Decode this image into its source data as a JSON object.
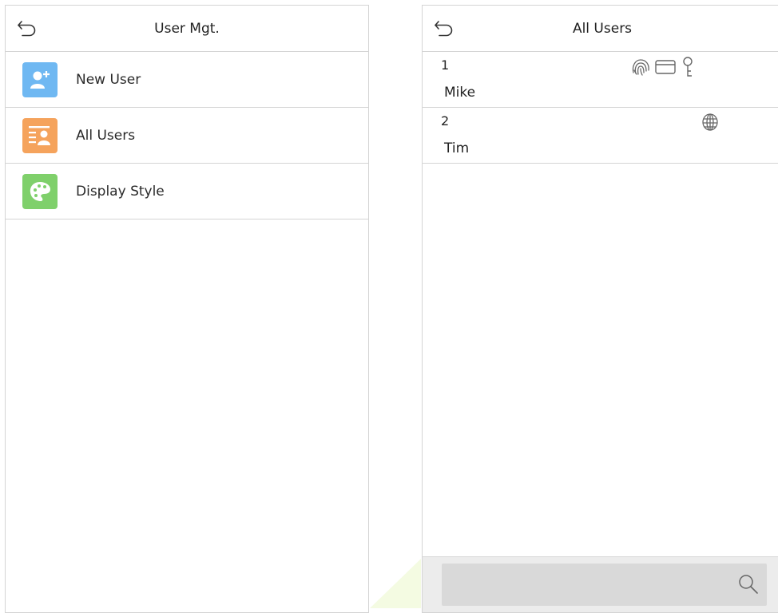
{
  "left_screen": {
    "title": "User Mgt.",
    "menu": [
      {
        "label": "New User",
        "icon": "new-user-icon",
        "color": "#6fb8f2"
      },
      {
        "label": "All Users",
        "icon": "all-users-icon",
        "color": "#f5a35c"
      },
      {
        "label": "Display Style",
        "icon": "palette-icon",
        "color": "#7fd06b"
      }
    ]
  },
  "right_screen": {
    "title": "All Users",
    "users": [
      {
        "id": "1",
        "name": "Mike",
        "verification_icons": [
          "fingerprint-icon",
          "card-icon",
          "key-icon"
        ]
      },
      {
        "id": "2",
        "name": "Tim",
        "verification_icons": [
          "face-icon"
        ]
      }
    ],
    "search": {
      "placeholder": ""
    }
  }
}
